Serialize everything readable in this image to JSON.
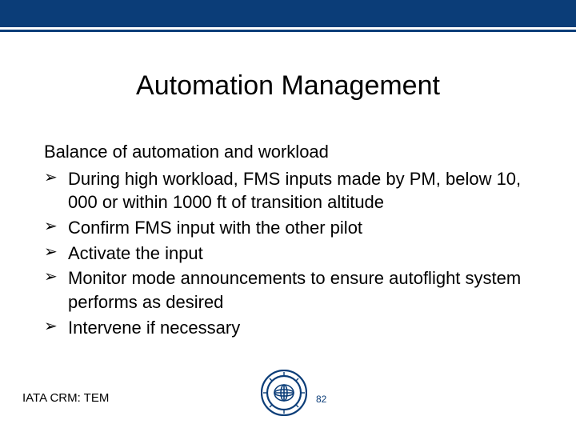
{
  "header": {
    "title": "Automation Management"
  },
  "body": {
    "lead": "Balance of automation and workload",
    "bullets": [
      "During high workload, FMS inputs made by PM, below 10, 000 or within 1000 ft of transition altitude",
      "Confirm FMS input with the other pilot",
      "Activate the input",
      "Monitor mode announcements to ensure autoflight system performs as desired",
      "Intervene if necessary"
    ]
  },
  "footer": {
    "course": "IATA CRM: TEM",
    "page_number": "82",
    "seal_label": "IATA"
  },
  "colors": {
    "brand": "#0b3d78"
  }
}
